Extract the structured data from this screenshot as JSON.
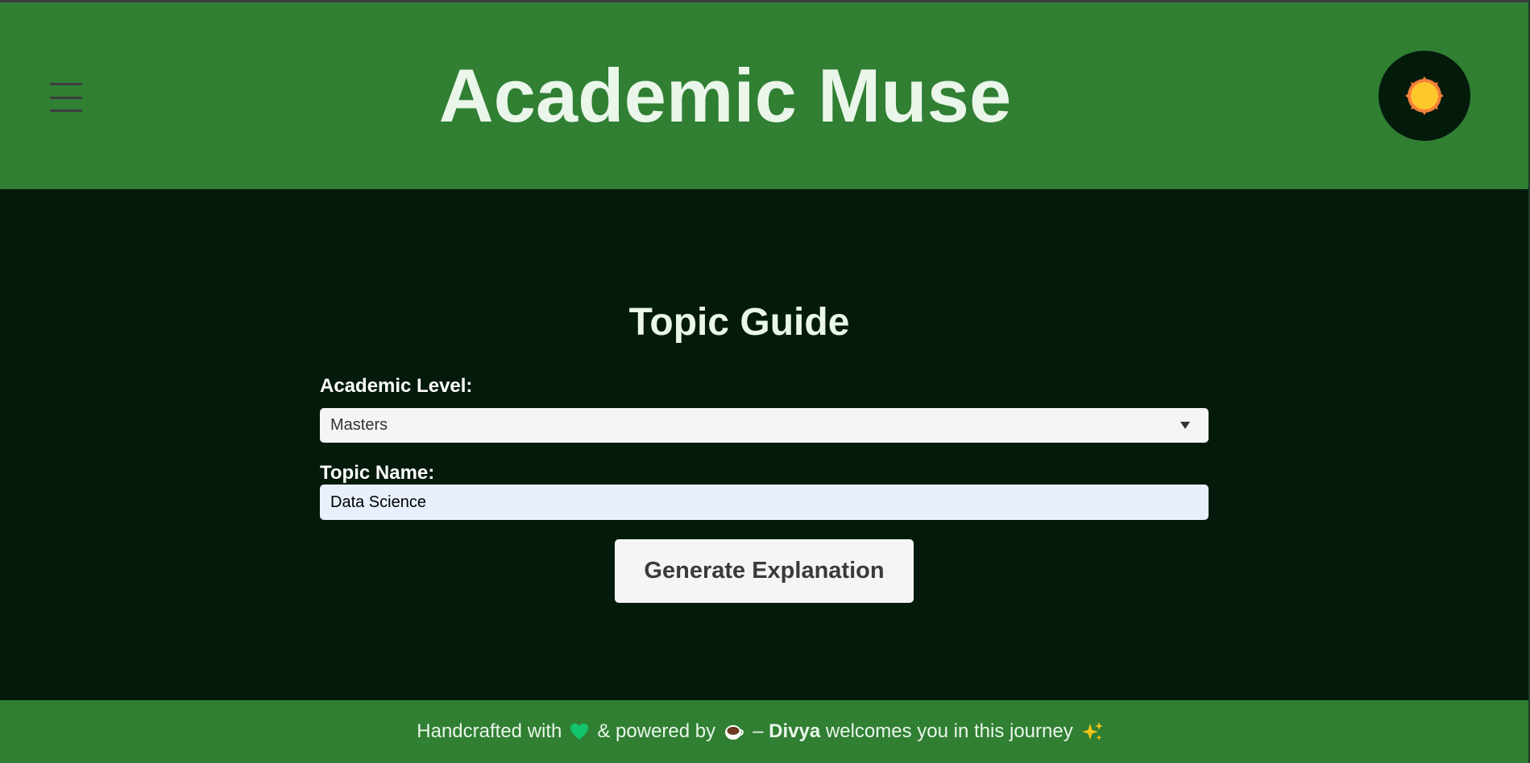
{
  "app": {
    "title": "Academic Muse"
  },
  "header": {
    "menu_icon": "hamburger-menu-icon",
    "theme_icon": "sun-icon"
  },
  "form": {
    "heading": "Topic Guide",
    "level_label": "Academic Level:",
    "level_value": "Masters",
    "topic_label": "Topic Name:",
    "topic_value": "Data Science",
    "submit_label": "Generate Explanation"
  },
  "footer": {
    "part1": "Handcrafted with",
    "part2": "& powered by",
    "part3": "–",
    "author": "Divya",
    "part4": "welcomes you in this journey",
    "icons": [
      "green-heart-icon",
      "coffee-icon",
      "sparkles-icon"
    ]
  },
  "colors": {
    "header_bg": "#307f33",
    "body_bg": "#041b0c",
    "title_text": "#eaf6ea",
    "sun": "#ffc72c",
    "sun_rim": "#f47f3a"
  }
}
